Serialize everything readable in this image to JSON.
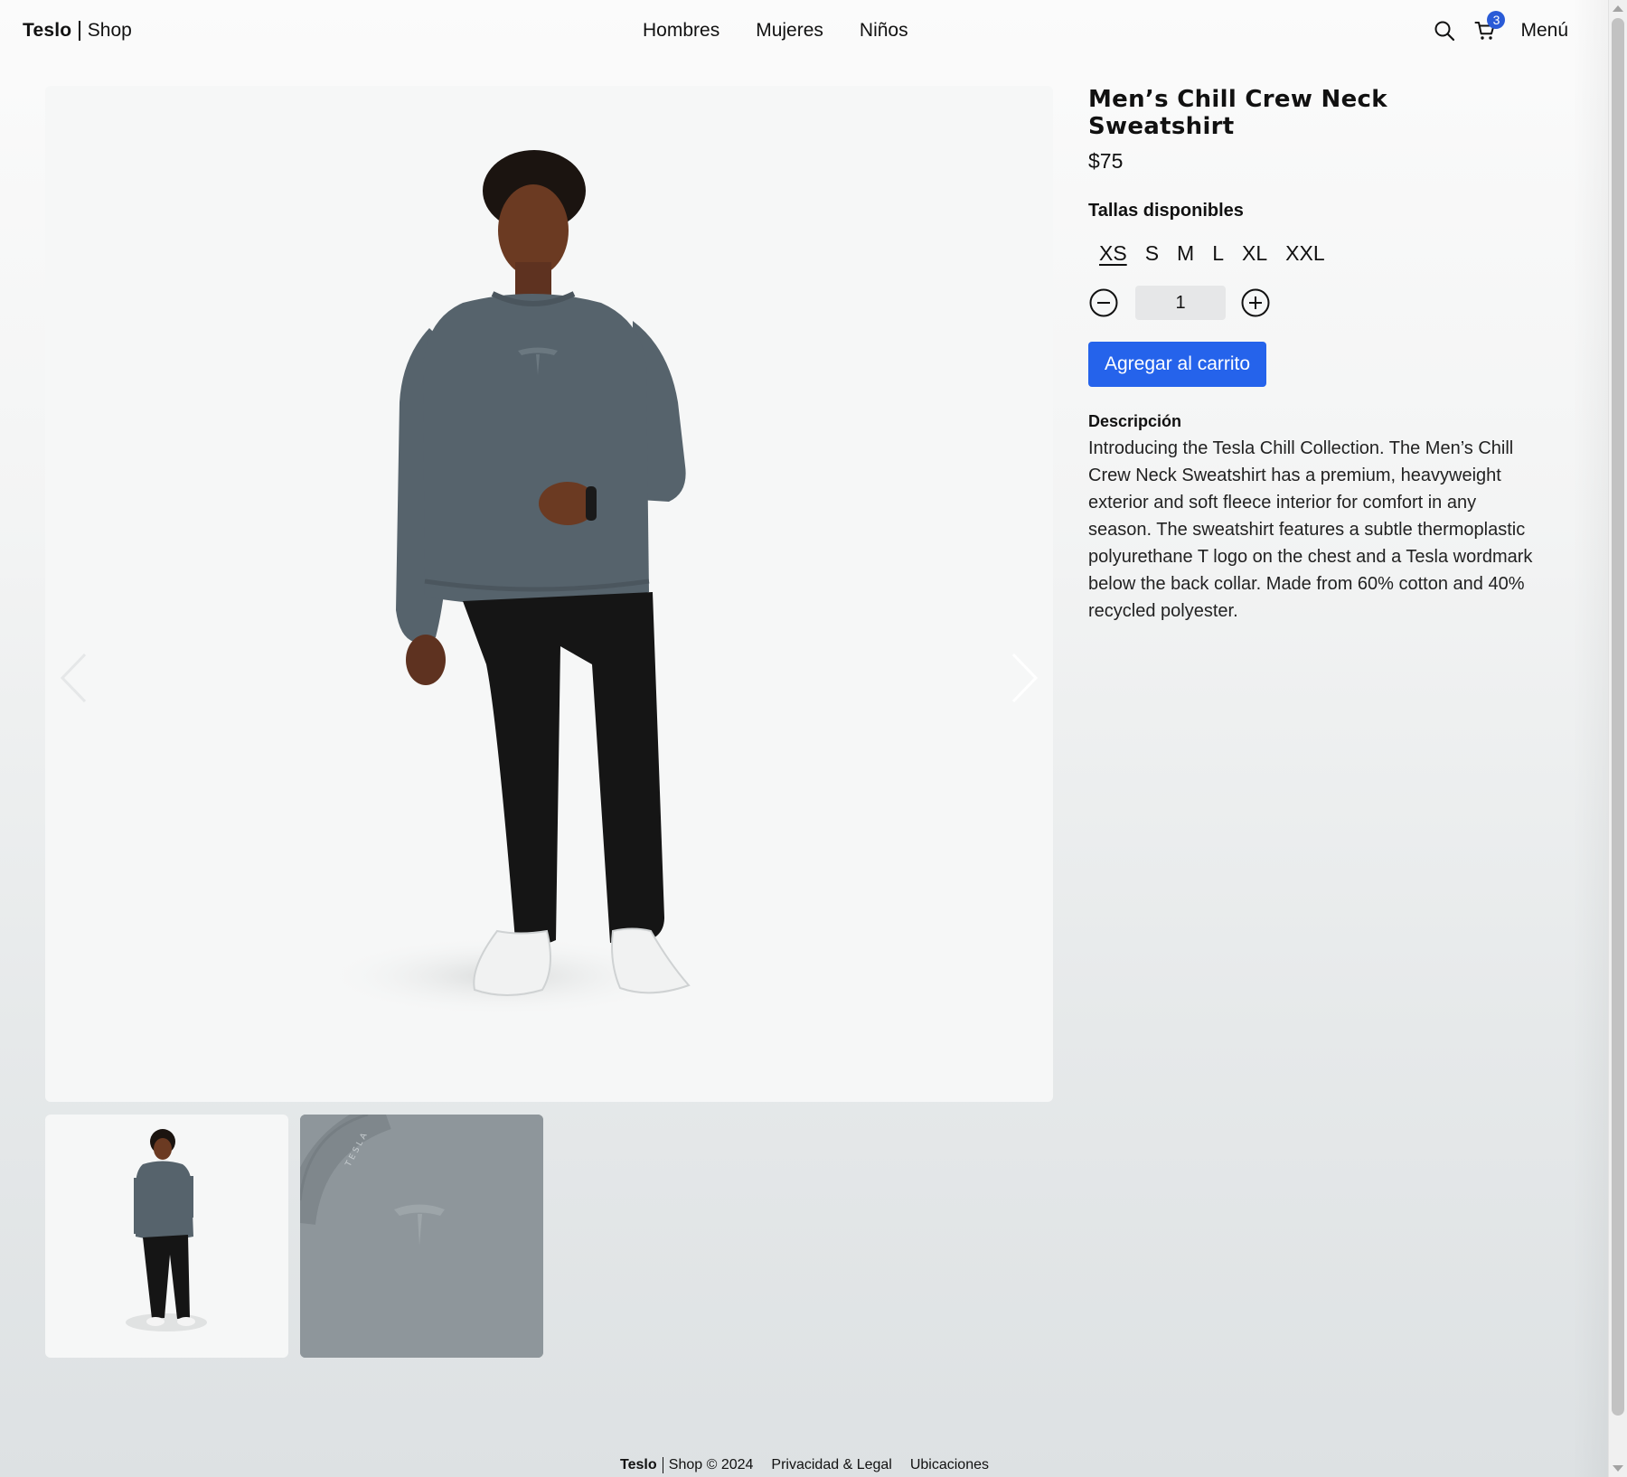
{
  "header": {
    "brand": "Teslo",
    "brand_suffix": "Shop",
    "nav": [
      "Hombres",
      "Mujeres",
      "Niños"
    ],
    "cart_count": "3",
    "menu_label": "Menú"
  },
  "product": {
    "title": "Men’s Chill Crew Neck Sweatshirt",
    "price": "$75",
    "sizes_label": "Tallas disponibles",
    "sizes": [
      "XS",
      "S",
      "M",
      "L",
      "XL",
      "XXL"
    ],
    "selected_size": "XS",
    "quantity": "1",
    "add_to_cart": "Agregar al carrito",
    "description_label": "Descripción",
    "description": "Introducing the Tesla Chill Collection. The Men’s Chill Crew Neck Sweatshirt has a premium, heavyweight exterior and soft fleece interior for comfort in any season. The sweatshirt features a subtle thermoplastic polyurethane T logo on the chest and a Tesla wordmark below the back collar. Made from 60% cotton and 40% recycled polyester."
  },
  "thumb_wordmark": "TESLA",
  "footer": {
    "brand": "Teslo",
    "brand_suffix": "Shop © 2024",
    "links": [
      "Privacidad & Legal",
      "Ubicaciones"
    ]
  },
  "colors": {
    "accent": "#2563eb",
    "badge": "#2a5bd7",
    "sweatshirt": "#56636c",
    "pants": "#151515"
  }
}
